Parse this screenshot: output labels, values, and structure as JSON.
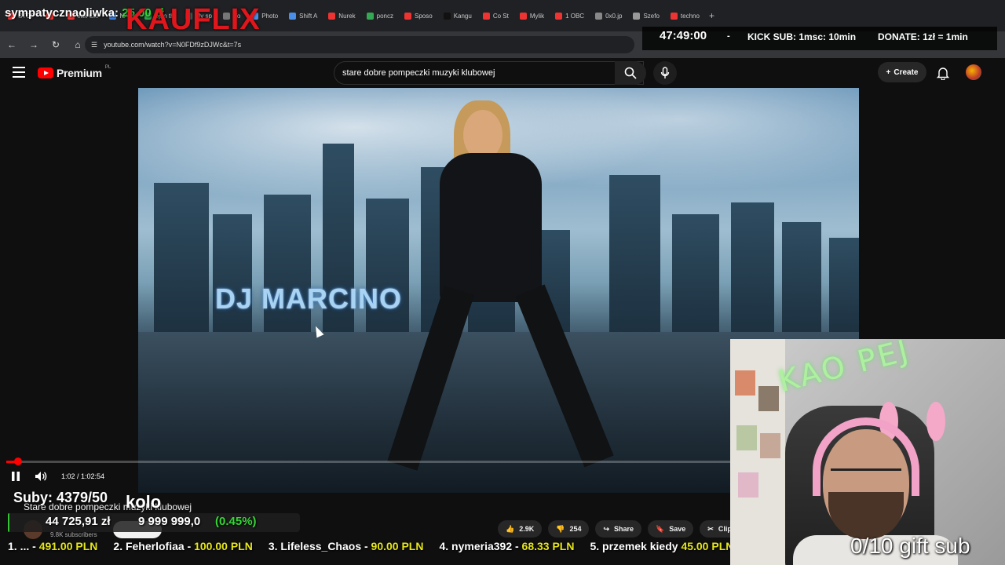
{
  "browser": {
    "tabs": [
      {
        "label": "STOP"
      },
      {
        "label": ""
      },
      {
        "label": "Jak Cie"
      },
      {
        "label": "NAG"
      },
      {
        "label": "Spin th"
      },
      {
        "label": "My sp"
      },
      {
        "label": "Vo"
      },
      {
        "label": "Photo"
      },
      {
        "label": "Shift A"
      },
      {
        "label": "Nurek"
      },
      {
        "label": "poncz"
      },
      {
        "label": "Sposo"
      },
      {
        "label": "Kangu"
      },
      {
        "label": "Co St"
      },
      {
        "label": "Mylik"
      },
      {
        "label": "1 OBC"
      },
      {
        "label": "0x0.jp"
      },
      {
        "label": "Szefo"
      },
      {
        "label": "techno"
      }
    ],
    "url": "youtube.com/watch?v=N0FDf9zDJWc&t=7s"
  },
  "youtube": {
    "logo_text": "Premium",
    "logo_region": "PL",
    "search_value": "stare dobre pompeczki muzyki klubowej",
    "create_label": "Create",
    "video_overlay_title": "DJ MARCINO",
    "time_current": "1:02",
    "time_total": "1:02:54",
    "time_display": "1:02 / 1:02:54",
    "progress_fraction": 0.0164,
    "video_title": "Stare dobre pompeczki muzyki klubowej",
    "channel_subs": "9.8K subscribers",
    "likes": "2.9K",
    "dislikes": "254",
    "share_label": "Share",
    "save_label": "Save",
    "clip_label": "Clip"
  },
  "overlay": {
    "top_left_name": "sympatycznaoliwka:",
    "top_left_amount": "25,00 zł",
    "brand": "KAUFLIX",
    "timer": "47:49:00",
    "dash": "-",
    "kick_sub": "KICK SUB: 1msc: 10min",
    "donate": "DONATE: 1zł = 1min",
    "subs_count": "Suby: 4379/50",
    "wheel_label": "kolo",
    "goal_current": "44 725,91 zł",
    "goal_target": "9 999 999,0",
    "goal_percent": "(0.45%)",
    "goal_fraction": 0.0045,
    "gift_sub": "0/10 gift sub",
    "neon_text": "KAO PEJ",
    "ticker": [
      {
        "name": "1. ... -",
        "amount": "491.00 PLN"
      },
      {
        "name": "2. Feherlofiaa -",
        "amount": "100.00 PLN"
      },
      {
        "name": "3. Lifeless_Chaos -",
        "amount": "90.00 PLN"
      },
      {
        "name": "4. nymeria392 -",
        "amount": "68.33 PLN"
      },
      {
        "name": "5. przemek kiedy",
        "amount": "45.00 PLN"
      }
    ]
  },
  "colors": {
    "youtube_red": "#ff0000",
    "goal_green": "#35d835",
    "ticker_amount": "#e6e61a",
    "brand_red": "#e0161d"
  },
  "icons": {
    "hamburger": "menu-icon",
    "search": "search-icon",
    "clear": "close-icon",
    "mic": "mic-icon",
    "bell": "bell-icon",
    "pause": "pause-icon",
    "volume": "volume-icon",
    "like": "thumbs-up-icon",
    "dislike": "thumbs-down-icon",
    "share": "share-icon",
    "save": "bookmark-icon",
    "clip": "scissors-icon"
  }
}
